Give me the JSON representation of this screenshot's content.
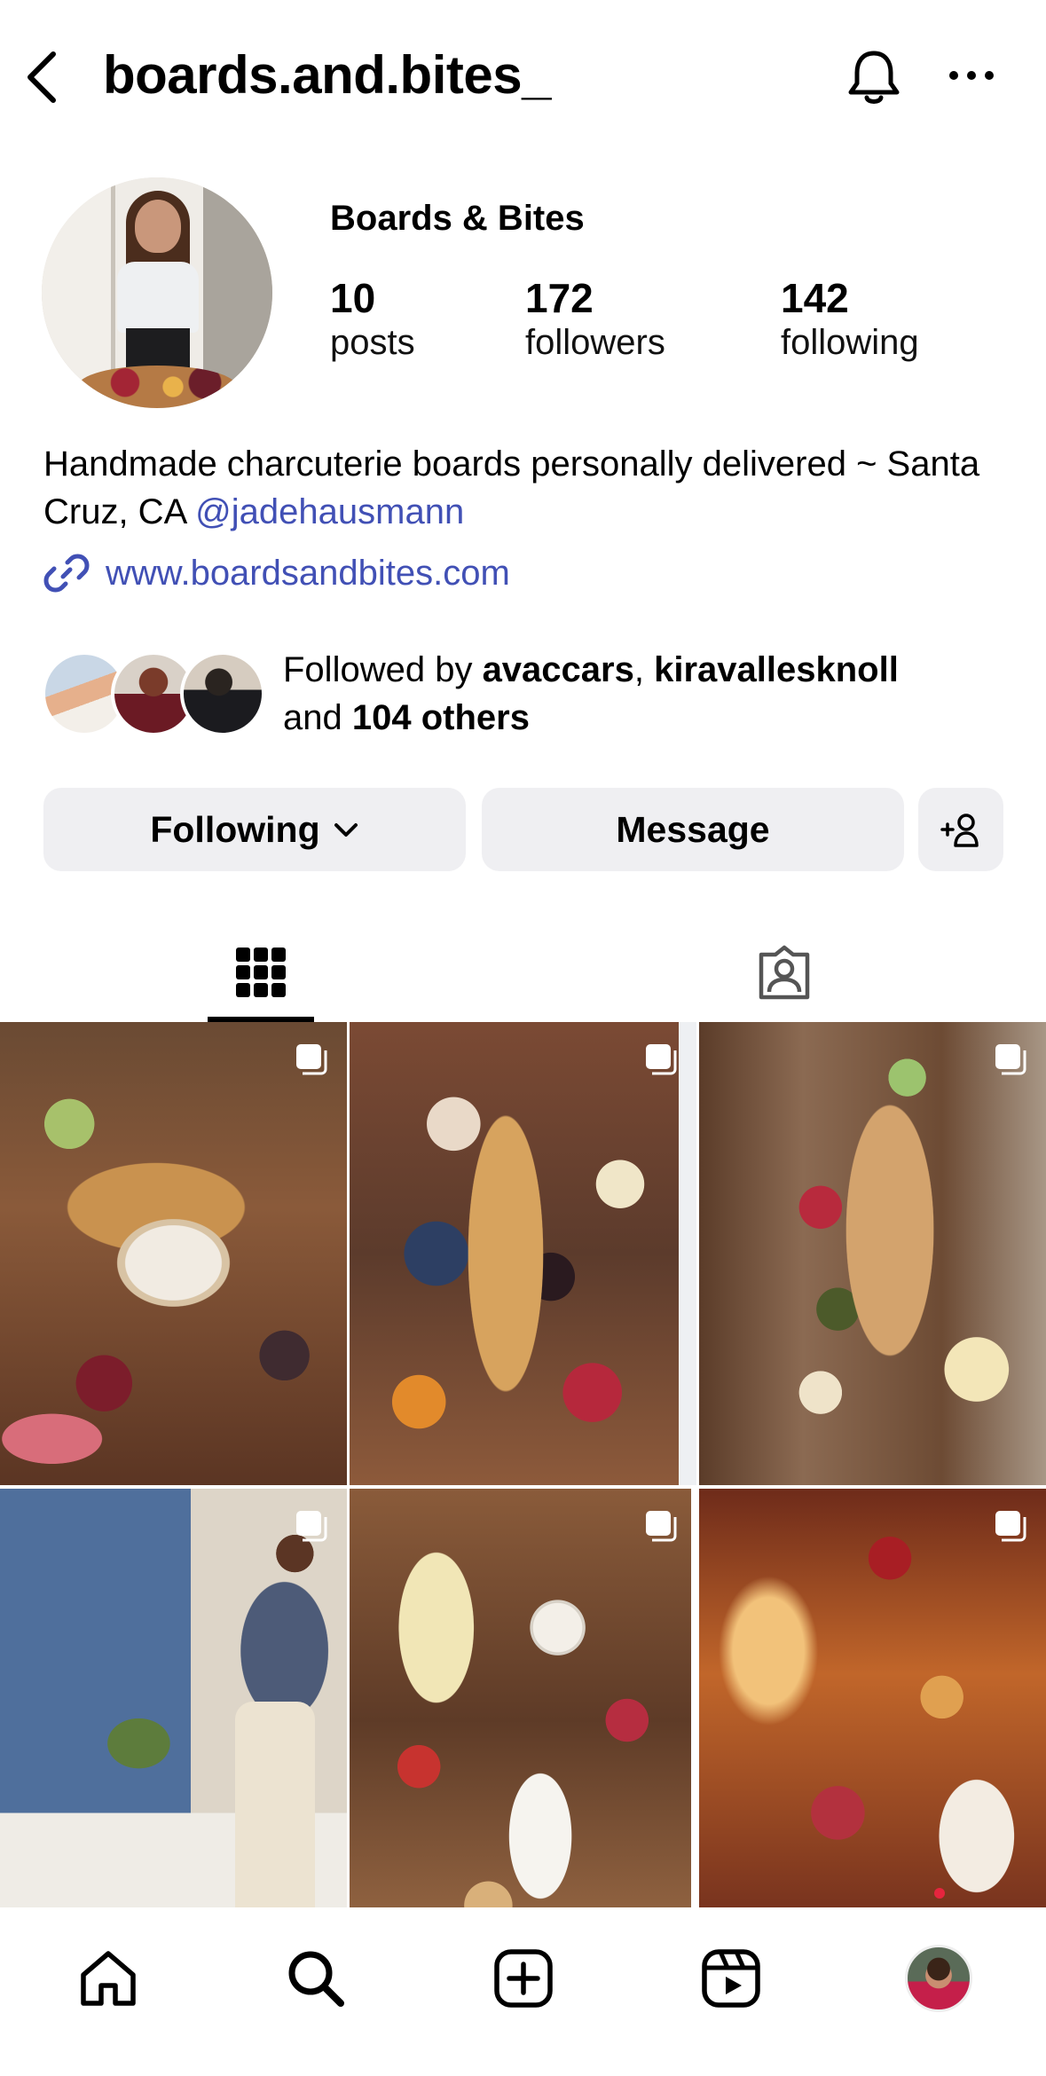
{
  "header": {
    "username": "boards.and.bites_"
  },
  "profile": {
    "display_name": "Boards & Bites",
    "stats": {
      "posts_count": "10",
      "posts_label": "posts",
      "followers_count": "172",
      "followers_label": "followers",
      "following_count": "142",
      "following_label": "following"
    },
    "bio_line": "Handmade charcuterie boards personally delivered ~ Santa Cruz, CA",
    "bio_mention": "@jadehausmann",
    "website": "www.boardsandbites.com"
  },
  "followed_by": {
    "prefix": "Followed by",
    "user1": "avaccars",
    "separator": ",",
    "user2": "kiravallesknoll",
    "and": "and",
    "others": "104 others"
  },
  "actions": {
    "following_label": "Following",
    "message_label": "Message"
  },
  "tabs": [
    {
      "name": "posts-grid",
      "icon": "grid-icon",
      "selected": true
    },
    {
      "name": "tagged",
      "icon": "tagged-person-icon",
      "selected": false
    }
  ],
  "grid": {
    "posts": [
      {
        "icon": "multiple-photos-icon"
      },
      {
        "icon": "multiple-photos-icon"
      },
      {
        "icon": "multiple-photos-icon"
      },
      {
        "icon": "multiple-photos-icon"
      },
      {
        "icon": "multiple-photos-icon"
      },
      {
        "icon": "multiple-photos-icon"
      }
    ]
  },
  "bottom_nav": {
    "items": [
      "home-icon",
      "search-icon",
      "create-icon",
      "reels-icon",
      "profile-avatar"
    ],
    "notification_dot_color": "#e5253e"
  },
  "colors": {
    "link": "#4150b5",
    "button_bg": "#efeff2"
  }
}
